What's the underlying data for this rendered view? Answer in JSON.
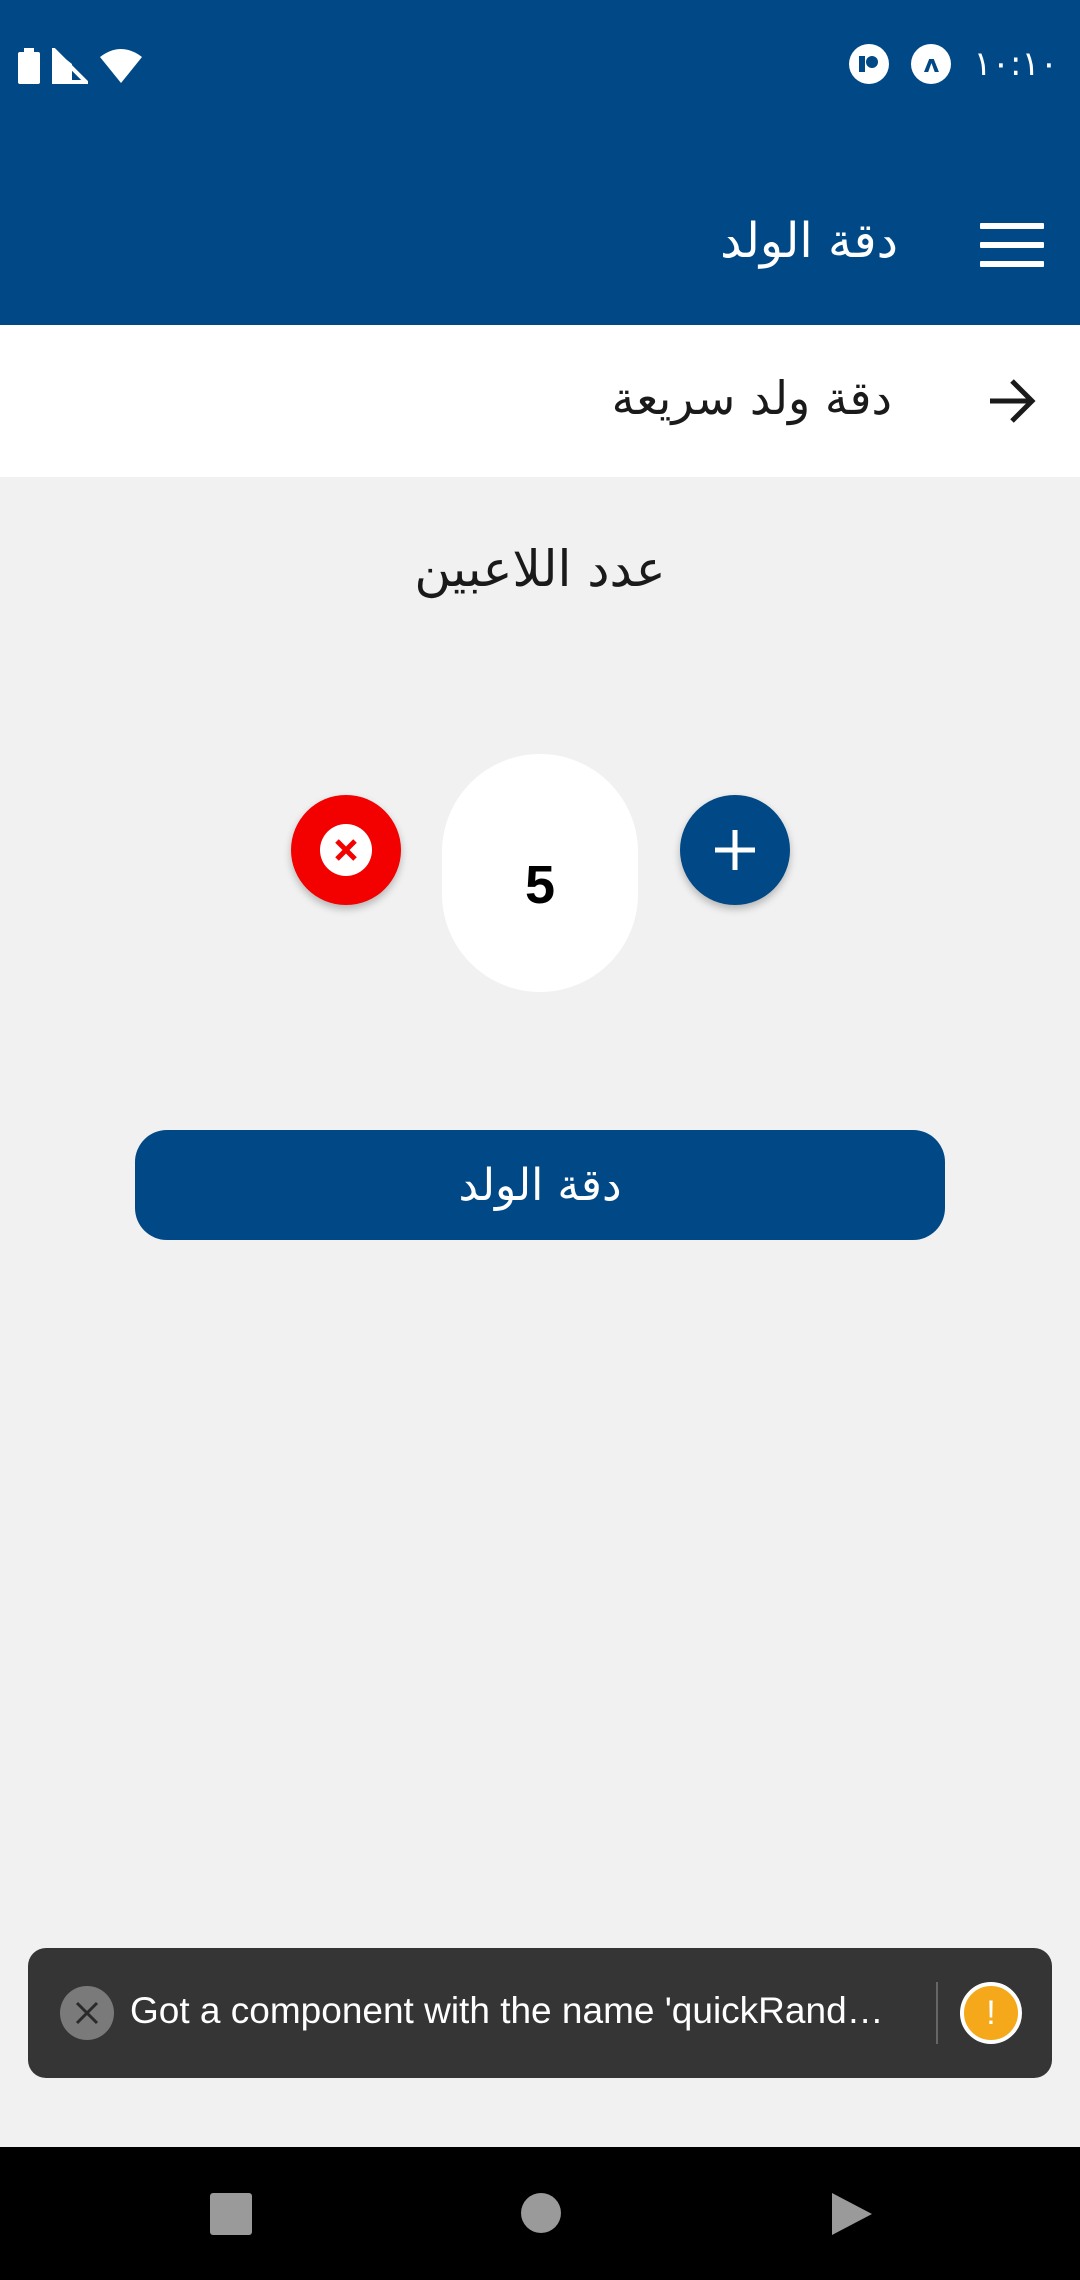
{
  "status_bar": {
    "time": "١٠:١٠",
    "left_icons": [
      "battery-icon",
      "signal-icon",
      "wifi-icon"
    ],
    "right_icons": [
      "app-notification-icon",
      "vpn-icon"
    ],
    "vpn_glyph": "ʌ"
  },
  "app_bar": {
    "title": "دقة الولد",
    "menu_icon": "hamburger-menu-icon"
  },
  "quick_row": {
    "label": "دقة ولد سريعة",
    "icon": "arrow-right-icon"
  },
  "players": {
    "label": "عدد اللاعبين",
    "count": "5",
    "decrease_icon": "close-circle-icon",
    "increase_icon": "plus-icon"
  },
  "primary_button": {
    "label": "دقة الولد"
  },
  "toast": {
    "message": "Got a component with the name 'quickRand…",
    "close_icon": "close-icon",
    "warning_icon": "warning-icon",
    "warning_glyph": "!"
  },
  "nav_bar": {
    "buttons": [
      "back-square-icon",
      "home-circle-icon",
      "recents-triangle-icon"
    ]
  },
  "colors": {
    "primary": "#014886",
    "danger": "#f30000",
    "background": "#f1f1f1",
    "toast_bg": "#353535",
    "warning": "#f5a91a"
  }
}
